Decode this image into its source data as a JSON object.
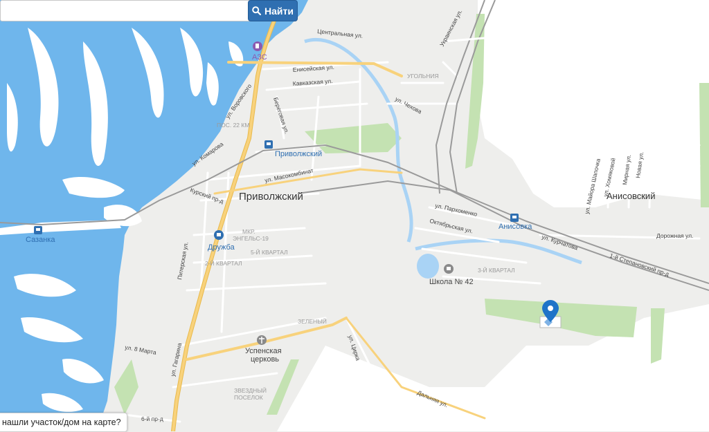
{
  "search": {
    "placeholder": "",
    "value": "",
    "button_label": "Найти",
    "button_icon": "search-icon"
  },
  "colors": {
    "water": "#6fb6ec",
    "land": "#eeeeec",
    "field": "#ffffff",
    "green": "#c4e2b2",
    "road_main": "#f8d27c",
    "road": "#ffffff",
    "rail": "#9a9a9a",
    "pin": "#1e74c8",
    "accent": "#2f6fb1"
  },
  "map": {
    "places": {
      "main_town": "Приволжский",
      "anisovsky": "Анисовский"
    },
    "stations": {
      "privolzhsky": "Приволжский",
      "anisovka": "Анисовка",
      "sazanka": "Сазанка",
      "druzhba": "Дружба"
    },
    "poi": {
      "azs": "АЗС",
      "school": "Школа № 42",
      "church_line1": "Успенская",
      "church_line2": "церковь"
    },
    "districts": {
      "ugolnyi": "УГОЛЬНИЯ",
      "pos22": "ПОС. 22 КМ",
      "mkr_line1": "МКР.",
      "mkr_line2": "ЭНГЕЛЬС-19",
      "kv5": "5-Й КВАРТАЛ",
      "kv2": "2-Й КВАРТАЛ",
      "kv3": "3-Й КВАРТАЛ",
      "zeleny": "ЗЕЛЕНЫЙ",
      "zvezd_line1": "ЗВЕЗДНЫЙ",
      "zvezd_line2": "ПОСЕЛОК"
    },
    "streets": {
      "centralnaya": "Центральная ул.",
      "ukrainskaya": "Украинская ул.",
      "eniseyskaya": "Енисейская ул.",
      "kavkazskaya": "Кавказская ул.",
      "vorovskogo": "ул. Воровского",
      "beregovaya": "Береговая ул.",
      "chekhova": "ул. Чехова",
      "komarova": "ул. Комарова",
      "masokombinat": "ул. Масокомбинат",
      "kursky": "Курский пр-д",
      "parkhomenko": "ул. Пархоменко",
      "oktyabrskaya": "Октябрьская ул.",
      "kurchatova": "ул. Курчатова",
      "stepnovskaya": "1-й Степановский пр-д",
      "dorozhnaya": "Дорожная ул.",
      "mayora": "ул. Майора Шапочка",
      "khomyakova": "ул. Хомяковой",
      "mirnaya": "Мирная ул.",
      "novaya": "Новая ул.",
      "piterskaya": "Питерская ул.",
      "gagarina": "ул. Гагарина",
      "march8": "ул. 8 Марта",
      "tsirka": "ул. Цирка",
      "dalnyaya": "Дальняя ул.",
      "pr6": "6-й пр-д"
    }
  },
  "hint": {
    "text": "нашли участок/дом на карте?"
  }
}
